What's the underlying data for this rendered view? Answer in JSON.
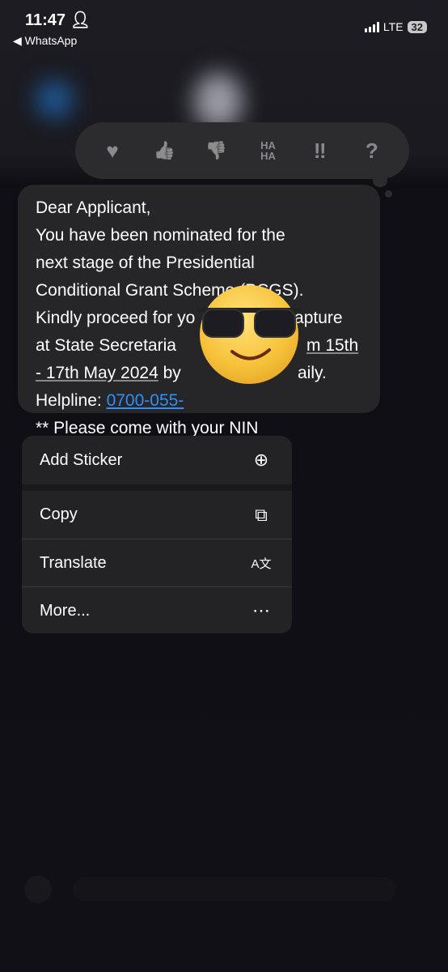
{
  "status_bar": {
    "time": "11:47",
    "back_app": "WhatsApp",
    "network": "LTE",
    "battery": "32"
  },
  "reactions": [
    {
      "icon": "heart-icon",
      "glyph": "♥"
    },
    {
      "icon": "thumbs-up-icon",
      "glyph": "👍"
    },
    {
      "icon": "thumbs-down-icon",
      "glyph": "👎"
    },
    {
      "icon": "haha-icon",
      "glyph": "HA HA"
    },
    {
      "icon": "exclamation-icon",
      "glyph": "‼"
    },
    {
      "icon": "question-icon",
      "glyph": "?"
    }
  ],
  "message": {
    "l1": "Dear Applicant,",
    "l2": "You have been nominated for the",
    "l3": "next stage of the Presidential",
    "l4": "Conditional Grant Scheme (PCGS).",
    "l5a": "Kindly proceed for yo",
    "l5b": "a capture",
    "l6a": "at State Secretaria",
    "l6b": "m 15th",
    "l7a": "- 17th May 2024",
    "l7b": " by",
    "l7c": "aily.",
    "l8a": "Helpline: ",
    "l8b": "0700-055-",
    "l9": "** Please come with your NIN",
    "link_color": "#2f8ff6"
  },
  "menu": [
    {
      "label": "Add Sticker",
      "icon": "add-sticker-icon"
    },
    {
      "label": "Copy",
      "icon": "copy-icon"
    },
    {
      "label": "Translate",
      "icon": "translate-icon"
    },
    {
      "label": "More...",
      "icon": "more-icon"
    }
  ]
}
